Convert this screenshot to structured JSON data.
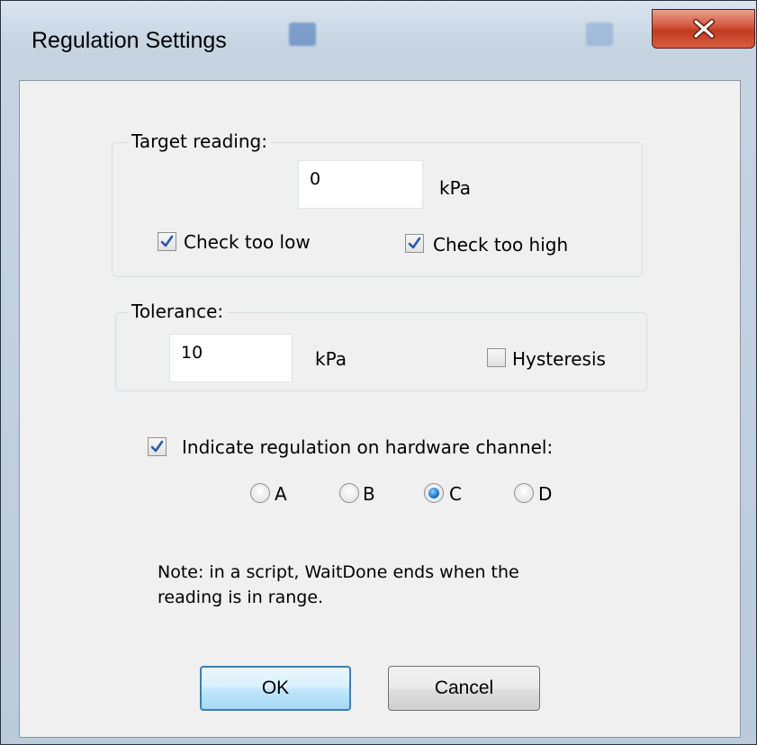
{
  "window": {
    "title": "Regulation Settings",
    "close_icon": "close-x-icon"
  },
  "target": {
    "group_label": "Target reading:",
    "value": "0",
    "unit": "kPa",
    "check_low": {
      "label": "Check too low",
      "checked": true
    },
    "check_high": {
      "label": "Check too high",
      "checked": true
    }
  },
  "tolerance": {
    "group_label": "Tolerance:",
    "value": "10",
    "unit": "kPa",
    "hysteresis": {
      "label": "Hysteresis",
      "checked": false
    }
  },
  "indicate": {
    "label": "Indicate regulation on hardware channel:",
    "checked": true,
    "channels": [
      {
        "label": "A",
        "selected": false
      },
      {
        "label": "B",
        "selected": false
      },
      {
        "label": "C",
        "selected": true
      },
      {
        "label": "D",
        "selected": false
      }
    ]
  },
  "note": {
    "line1": "Note: in a script, WaitDone ends when the",
    "line2": "reading is in range."
  },
  "buttons": {
    "ok": "OK",
    "cancel": "Cancel"
  },
  "colors": {
    "check_mark": "#2a58a8",
    "radio_selected": "#1a74c8",
    "close_button": "#c94a30"
  }
}
